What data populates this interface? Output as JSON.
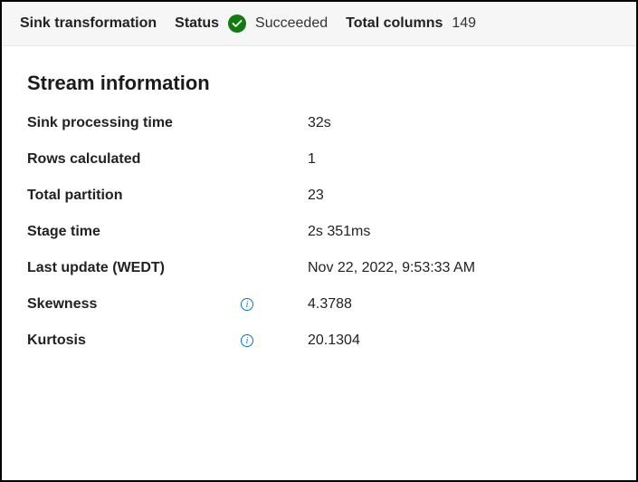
{
  "header": {
    "transformation_label": "Sink transformation",
    "status_label": "Status",
    "status_value": "Succeeded",
    "columns_label": "Total columns",
    "columns_value": "149"
  },
  "section": {
    "title": "Stream information"
  },
  "rows": [
    {
      "label": "Sink processing time",
      "value": "32s",
      "info": false
    },
    {
      "label": "Rows calculated",
      "value": "1",
      "info": false
    },
    {
      "label": "Total partition",
      "value": "23",
      "info": false
    },
    {
      "label": "Stage time",
      "value": "2s 351ms",
      "info": false
    },
    {
      "label": "Last update (WEDT)",
      "value": "Nov 22, 2022, 9:53:33 AM",
      "info": false
    },
    {
      "label": "Skewness",
      "value": "4.3788",
      "info": true
    },
    {
      "label": "Kurtosis",
      "value": "20.1304",
      "info": true
    }
  ]
}
